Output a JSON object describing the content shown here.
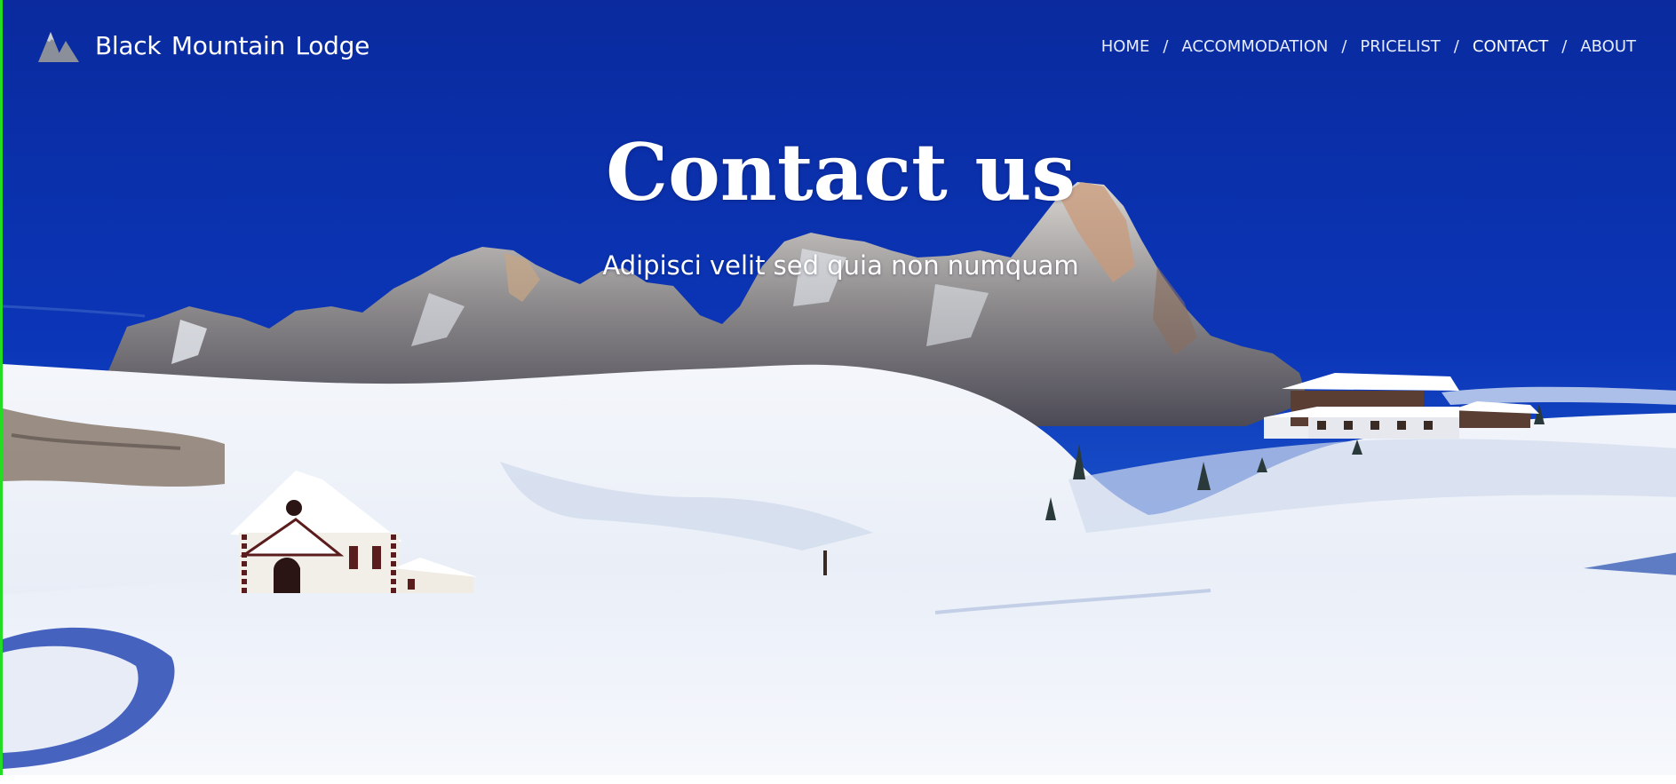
{
  "brand": {
    "name": "Black Mountain  Lodge",
    "logo_icon": "mountain-logo-icon"
  },
  "nav": {
    "items": [
      {
        "label": "HOME"
      },
      {
        "label": "ACCOMMODATION"
      },
      {
        "label": "PRICELIST"
      },
      {
        "label": "CONTACT"
      },
      {
        "label": "ABOUT"
      }
    ],
    "separator": "/",
    "active": "CONTACT"
  },
  "hero": {
    "title": "Contact us",
    "subtitle": "Adipisci velit sed quia non numquam"
  },
  "colors": {
    "sky": "#0a2ea8",
    "snow": "#eef2fa",
    "accent_border": "#22dd22"
  }
}
